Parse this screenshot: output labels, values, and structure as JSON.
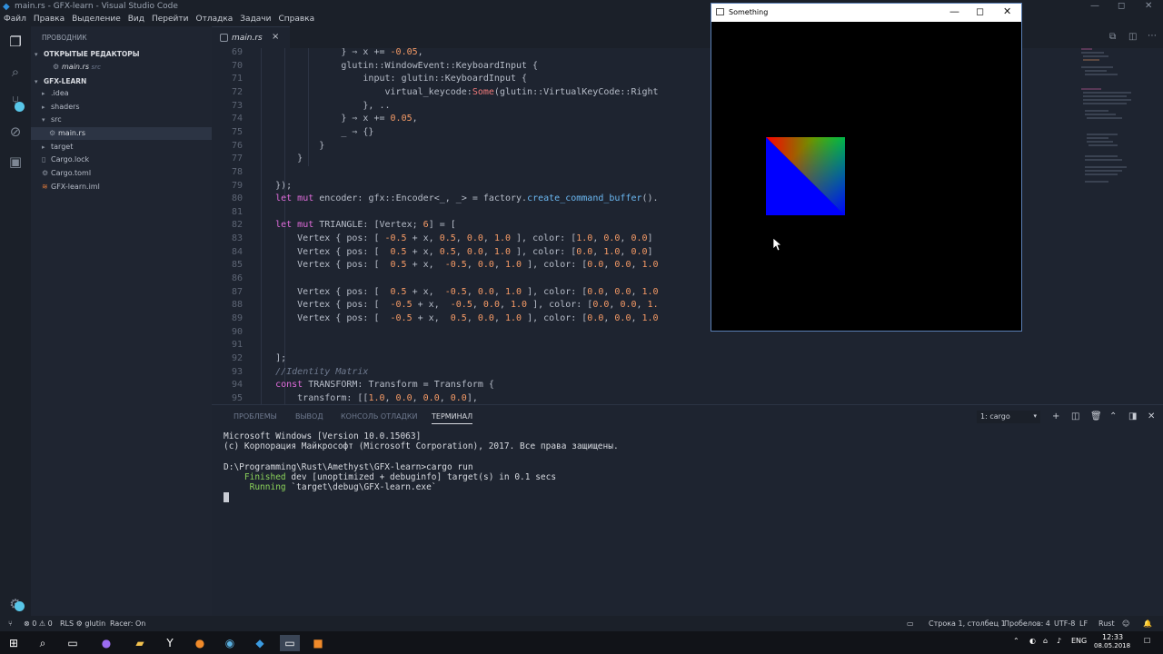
{
  "window": {
    "title": "main.rs - GFX-learn - Visual Studio Code"
  },
  "menu": [
    "Файл",
    "Правка",
    "Выделение",
    "Вид",
    "Перейти",
    "Отладка",
    "Задачи",
    "Справка"
  ],
  "sidebar": {
    "header": "ПРОВОДНИК",
    "open_editors_label": "ОТКРЫТЫЕ РЕДАКТОРЫ",
    "open_editor": {
      "name": "main.rs",
      "dir": "src"
    },
    "project_label": "GFX-LEARN",
    "items": [
      {
        "label": ".idea"
      },
      {
        "label": "shaders"
      },
      {
        "label": "src"
      },
      {
        "label": "main.rs"
      },
      {
        "label": "target"
      },
      {
        "label": "Cargo.lock"
      },
      {
        "label": "Cargo.toml"
      },
      {
        "label": "GFX-learn.iml"
      }
    ]
  },
  "tab": {
    "label": "main.rs",
    "close": "×"
  },
  "editor": {
    "line_numbers": [
      "69",
      "70",
      "71",
      "72",
      "73",
      "74",
      "75",
      "76",
      "77",
      "78",
      "79",
      "80",
      "81",
      "82",
      "83",
      "84",
      "85",
      "86",
      "87",
      "88",
      "89",
      "90",
      "91",
      "92",
      "93",
      "94",
      "95"
    ]
  },
  "panel": {
    "tabs": [
      "ПРОБЛЕМЫ",
      "ВЫВОД",
      "КОНСОЛЬ ОТЛАДКИ",
      "ТЕРМИНАЛ"
    ],
    "terminal_select": "1: cargo",
    "lines": [
      "Microsoft Windows [Version 10.0.15063]",
      "(c) Корпорация Майкрософт (Microsoft Corporation), 2017. Все права защищены.",
      "",
      "D:\\Programming\\Rust\\Amethyst\\GFX-learn>cargo run",
      "    Finished dev [unoptimized + debuginfo] target(s) in 0.1 secs",
      "     Running `target\\debug\\GFX-learn.exe`"
    ],
    "finished_word": "Finished",
    "running_word": "Running"
  },
  "status": {
    "errors": "⊗ 0 ⚠ 0",
    "rls": "RLS ⚙ glutin",
    "racer": "Racer: On",
    "position": "Строка 1, столбец 1",
    "spaces": "Пробелов: 4",
    "encoding": "UTF-8",
    "eol": "LF",
    "language": "Rust"
  },
  "floating_window": {
    "title": "Something"
  },
  "taskbar": {
    "lang": "ENG",
    "time": "12:33",
    "date": "08.05.2018"
  },
  "colors": {
    "accent": "#58c6e8",
    "keyword": "#e06cdb",
    "number": "#f69b66",
    "function": "#6bb8f2"
  }
}
